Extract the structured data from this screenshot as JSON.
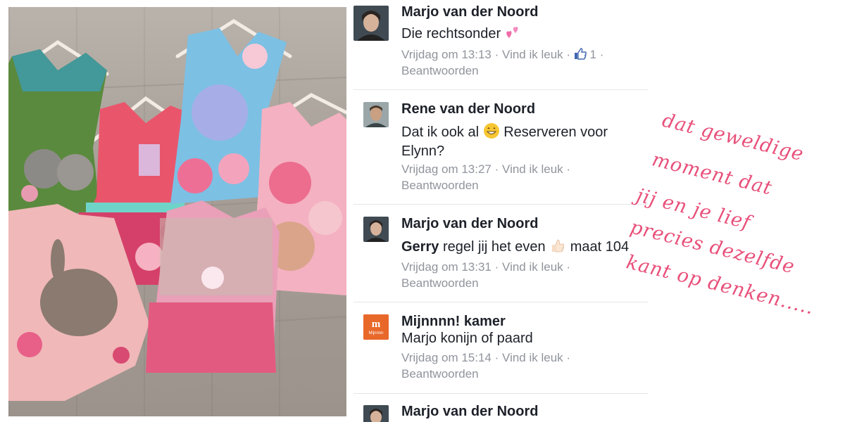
{
  "comments": [
    {
      "author": "Marjo van der Noord",
      "text": "Die rechtsonder",
      "emoji": "two-hearts",
      "time": "Vrijdag om 13:13",
      "like": "Vind ik leuk",
      "like_count": "1",
      "reply": "Beantwoorden"
    },
    {
      "author": "Rene van der Noord",
      "text_before": "Dat ik ook al",
      "emoji": "grinning-face",
      "text_after": "Reserveren voor Elynn?",
      "time": "Vrijdag om 13:27",
      "like": "Vind ik leuk",
      "reply": "Beantwoorden"
    },
    {
      "author": "Marjo van der Noord",
      "mention": "Gerry",
      "text_before": "regel jij het even",
      "emoji": "thumbs-up",
      "text_after": "maat 104",
      "time": "Vrijdag om 13:31",
      "like": "Vind ik leuk",
      "reply": "Beantwoorden"
    },
    {
      "author": "Mijnnnn! kamer",
      "text": "Marjo konijn of paard",
      "time": "Vrijdag om 15:14",
      "like": "Vind ik leuk",
      "reply": "Beantwoorden",
      "avatar_logo": "Mijnnnn"
    },
    {
      "author": "Marjo van der Noord"
    }
  ],
  "separator": "·",
  "annotation": [
    "dat geweldige",
    "moment dat",
    "jij en je lief",
    "precies dezelfde",
    "kant op denken....."
  ],
  "colors": {
    "meta_grey": "#90949c",
    "text_dark": "#1d2129",
    "like_blue": "#4267b2",
    "annotation_pink": "#e8507a",
    "logo_orange": "#e8682a"
  }
}
